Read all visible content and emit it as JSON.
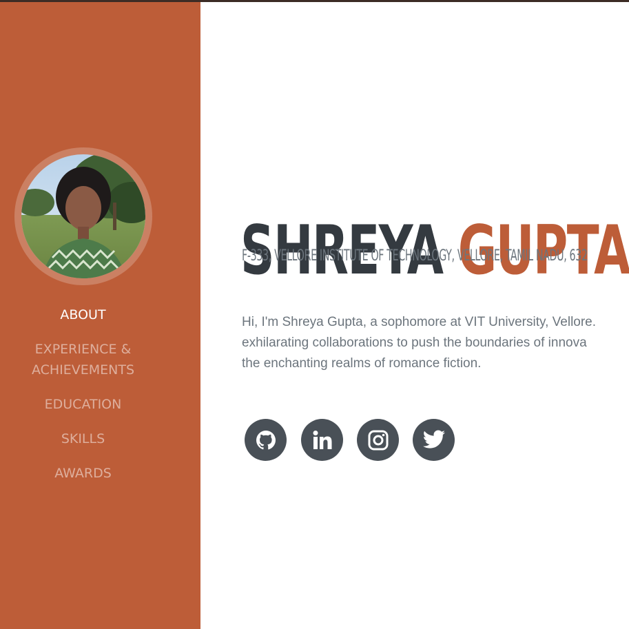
{
  "profile": {
    "first_name": "SHREYA",
    "last_name": "GUPTA",
    "address": "F-333, VELLORE INSTITUTE OF TECHNOLOGY, VELLORE, TAMIL NADU, 632",
    "bio_lines": [
      "Hi, I'm Shreya Gupta, a sophomore at VIT University, Vellore.",
      "exhilarating collaborations to push the boundaries of innova",
      "the enchanting realms of romance fiction."
    ]
  },
  "nav": {
    "items": [
      {
        "label": "ABOUT",
        "active": true
      },
      {
        "label_line1": "EXPERIENCE &",
        "label_line2": "ACHIEVEMENTS",
        "active": false
      },
      {
        "label": "EDUCATION",
        "active": false
      },
      {
        "label": "SKILLS",
        "active": false
      },
      {
        "label": "AWARDS",
        "active": false
      }
    ]
  },
  "social": [
    {
      "icon": "github-icon"
    },
    {
      "icon": "linkedin-icon"
    },
    {
      "icon": "instagram-icon"
    },
    {
      "icon": "twitter-icon"
    }
  ],
  "colors": {
    "primary": "#bd5d38",
    "dark": "#343a40",
    "muted": "#6c757d",
    "social_bg": "#495057"
  }
}
